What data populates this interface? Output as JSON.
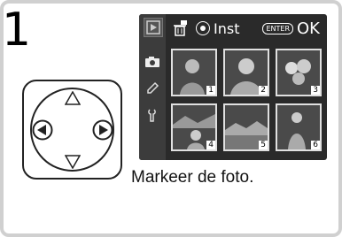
{
  "step_number": "1",
  "screen": {
    "delete_label": "Inst",
    "ok_label": "OK",
    "enter_label": "ENTER",
    "thumbnails": [
      {
        "number": "1"
      },
      {
        "number": "2"
      },
      {
        "number": "3"
      },
      {
        "number": "4"
      },
      {
        "number": "5"
      },
      {
        "number": "6"
      }
    ],
    "side_tabs": [
      "playback-icon",
      "camera-icon",
      "pencil-icon",
      "wrench-icon"
    ]
  },
  "caption": "Markeer de foto."
}
